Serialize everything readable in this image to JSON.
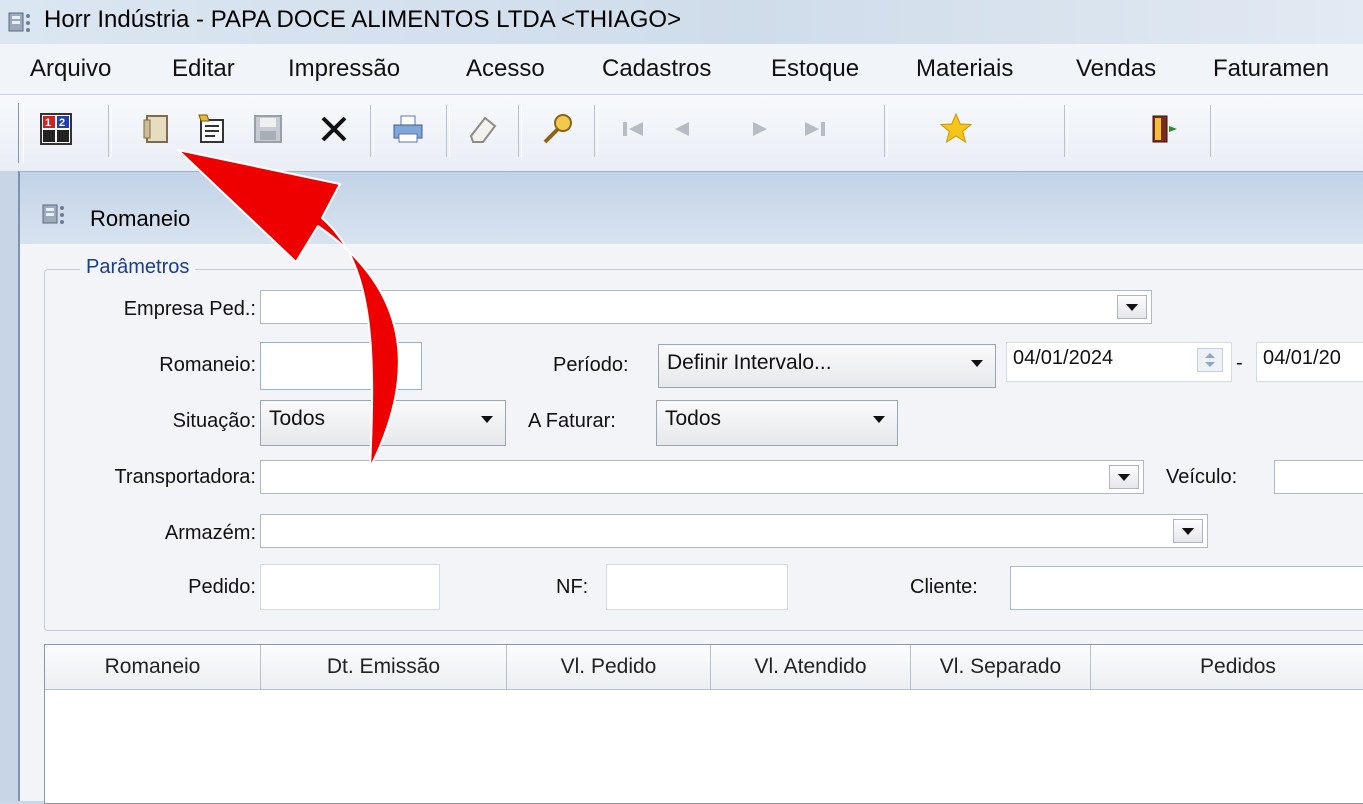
{
  "window": {
    "title": "Horr Indústria - PAPA DOCE ALIMENTOS LTDA <THIAGO>"
  },
  "menu": [
    {
      "label": "Arquivo"
    },
    {
      "label": "Editar"
    },
    {
      "label": "Impressão"
    },
    {
      "label": "Acesso"
    },
    {
      "label": "Cadastros"
    },
    {
      "label": "Estoque"
    },
    {
      "label": "Materiais"
    },
    {
      "label": "Vendas"
    },
    {
      "label": "Faturamen"
    }
  ],
  "toolbar": {
    "icons": [
      "calculator-icon",
      "new-record-icon",
      "edit-record-icon",
      "save-icon",
      "delete-icon",
      "print-icon",
      "clear-icon",
      "search-icon",
      "first-record-icon",
      "previous-record-icon",
      "next-record-icon",
      "last-record-icon",
      "favorite-star-icon",
      "exit-door-icon"
    ]
  },
  "child_window": {
    "title": "Romaneio"
  },
  "parameters": {
    "legend": "Parâmetros",
    "empresa_label": "Empresa Ped.:",
    "empresa_value": "",
    "romaneio_label": "Romaneio:",
    "romaneio_value": "",
    "periodo_label": "Período:",
    "periodo_value": "Definir Intervalo...",
    "date_from": "04/01/2024",
    "date_separator": "-",
    "date_to": "04/01/20",
    "situacao_label": "Situação:",
    "situacao_value": "Todos",
    "a_faturar_label": "A Faturar:",
    "a_faturar_value": "Todos",
    "transportadora_label": "Transportadora:",
    "transportadora_value": "",
    "veiculo_label": "Veículo:",
    "veiculo_value": "",
    "armazem_label": "Armazém:",
    "armazem_value": "",
    "pedido_label": "Pedido:",
    "pedido_value": "",
    "nf_label": "NF:",
    "nf_value": "",
    "cliente_label": "Cliente:",
    "cliente_value": ""
  },
  "grid": {
    "columns": [
      "Romaneio",
      "Dt. Emissão",
      "Vl. Pedido",
      "Vl. Atendido",
      "Vl. Separado",
      "Pedidos"
    ],
    "rows": []
  },
  "colors": {
    "annotation_arrow": "#ee0000",
    "title_bar": "#d6e2ef",
    "legend_text": "#1a3d8f"
  }
}
